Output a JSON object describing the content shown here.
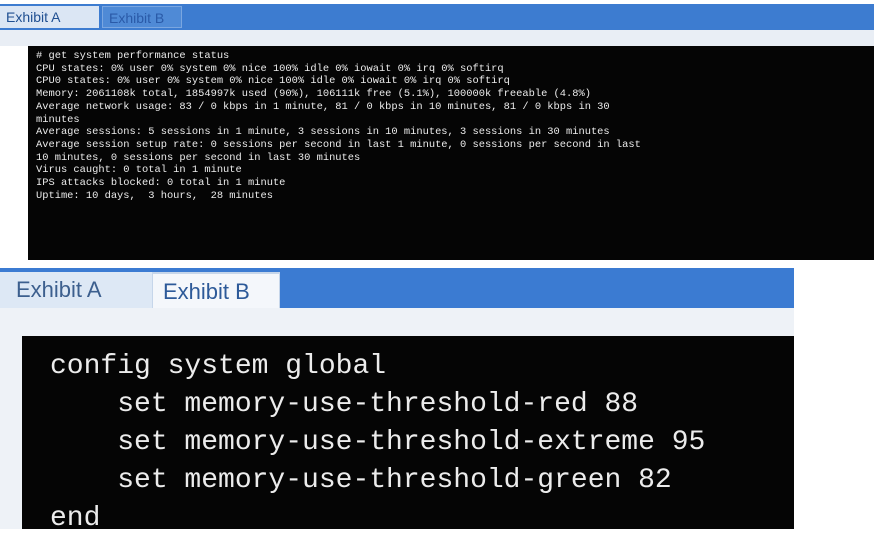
{
  "exhibit_a_view": {
    "tabs": [
      {
        "label": "Exhibit A",
        "active": true
      },
      {
        "label": "Exhibit B",
        "active": false
      }
    ],
    "terminal_lines": [
      "# get system performance status",
      "CPU states: 0% user 0% system 0% nice 100% idle 0% iowait 0% irq 0% softirq",
      "CPU0 states: 0% user 0% system 0% nice 100% idle 0% iowait 0% irq 0% softirq",
      "Memory: 2061108k total, 1854997k used (90%), 106111k free (5.1%), 100000k freeable (4.8%)",
      "Average network usage: 83 / 0 kbps in 1 minute, 81 / 0 kbps in 10 minutes, 81 / 0 kbps in 30",
      "minutes",
      "Average sessions: 5 sessions in 1 minute, 3 sessions in 10 minutes, 3 sessions in 30 minutes",
      "Average session setup rate: 0 sessions per second in last 1 minute, 0 sessions per second in last",
      "10 minutes, 0 sessions per second in last 30 minutes",
      "Virus caught: 0 total in 1 minute",
      "IPS attacks blocked: 0 total in 1 minute",
      "Uptime: 10 days,  3 hours,  28 minutes"
    ]
  },
  "exhibit_b_view": {
    "tabs": [
      {
        "label": "Exhibit A",
        "active": false
      },
      {
        "label": "Exhibit B",
        "active": true
      }
    ],
    "terminal_lines": [
      "config system global",
      "    set memory-use-threshold-red 88",
      "    set memory-use-threshold-extreme 95",
      "    set memory-use-threshold-green 82",
      "end"
    ]
  },
  "colors": {
    "tab_bar_blue": "#3d7cd0",
    "terminal_bg": "#050505",
    "terminal_text": "#ececec"
  }
}
